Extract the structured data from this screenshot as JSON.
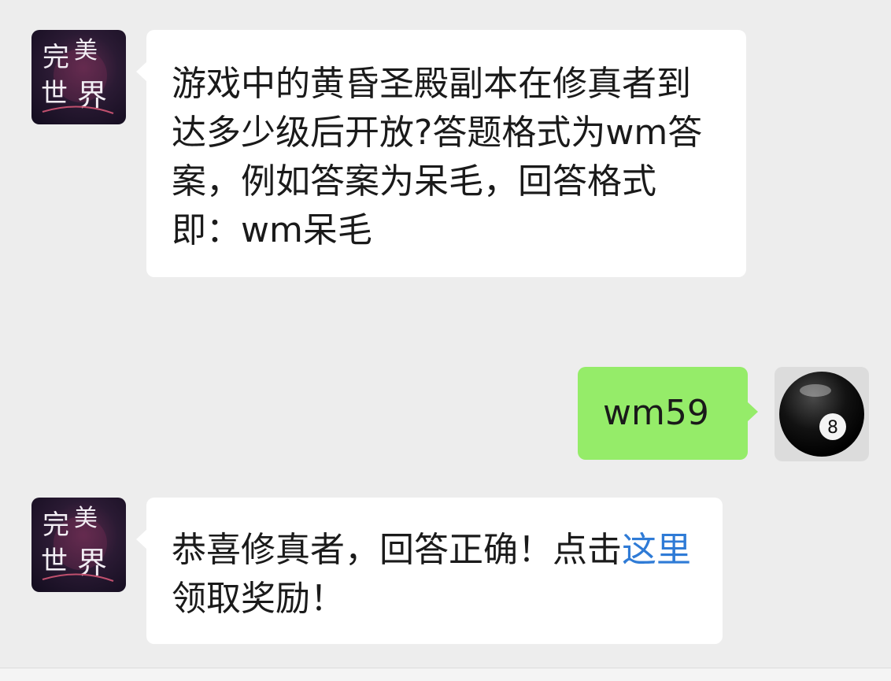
{
  "messages": [
    {
      "sender": "game-account",
      "direction": "incoming",
      "avatar": {
        "icon": "perfect-world-logo",
        "logo_text": [
          "完",
          "美",
          "世",
          "界"
        ]
      },
      "text": "游戏中的黄昏圣殿副本在修真者到达多少级后开放?答题格式为wm答案，例如答案为呆毛，回答格式即：wm呆毛"
    },
    {
      "sender": "user",
      "direction": "outgoing",
      "avatar": {
        "icon": "eight-ball-icon",
        "ball_number": "8"
      },
      "text": "wm59"
    },
    {
      "sender": "game-account",
      "direction": "incoming",
      "avatar": {
        "icon": "perfect-world-logo",
        "logo_text": [
          "完",
          "美",
          "世",
          "界"
        ]
      },
      "text_before": "恭喜修真者，回答正确！点击",
      "link_text": "这里",
      "text_after": "领取奖励！"
    }
  ],
  "colors": {
    "background": "#ededed",
    "incoming_bubble": "#ffffff",
    "outgoing_bubble": "#95ec69",
    "link": "#2f7bd6"
  }
}
